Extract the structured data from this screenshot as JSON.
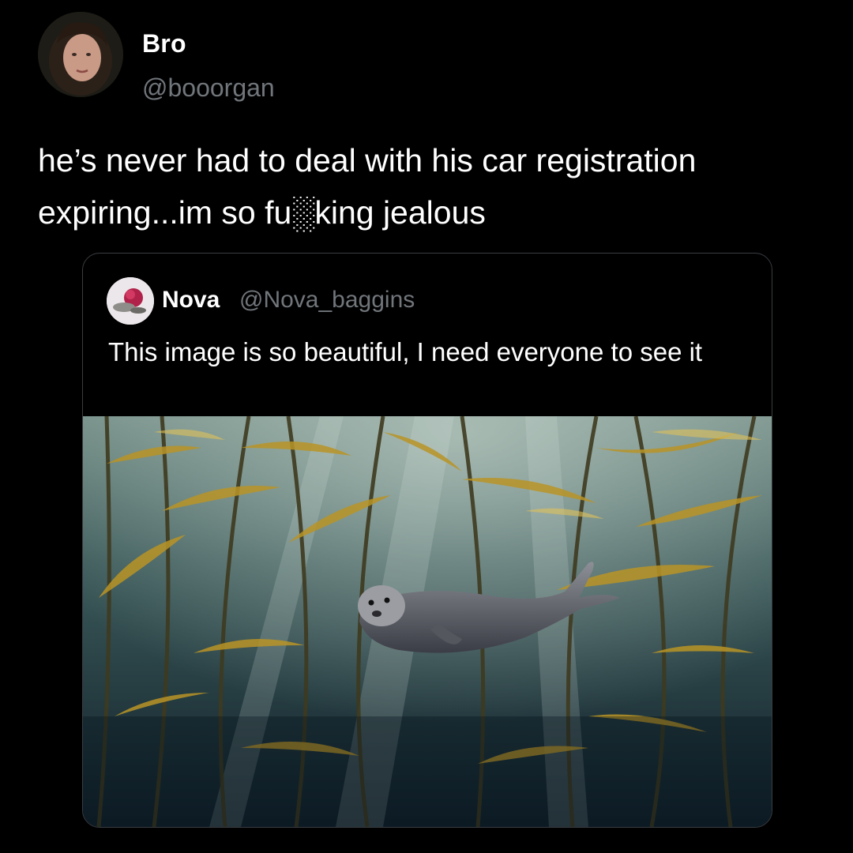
{
  "tweet": {
    "author": {
      "display_name": "Bro",
      "handle": "@booorgan"
    },
    "text": "he’s never had to deal with his car registration expiring...im so fu░king jealous",
    "quoted_tweet": {
      "author": {
        "display_name": "Nova",
        "handle": "@Nova_baggins"
      },
      "text": "This image is so beautiful, I need everyone to see it",
      "media": {
        "kind": "photo",
        "subject": "seal-in-kelp-forest"
      }
    }
  },
  "colors": {
    "background": "#000000",
    "primary_text": "#ffffff",
    "secondary_text": "#71767b",
    "card_border": "#3a3d41"
  }
}
